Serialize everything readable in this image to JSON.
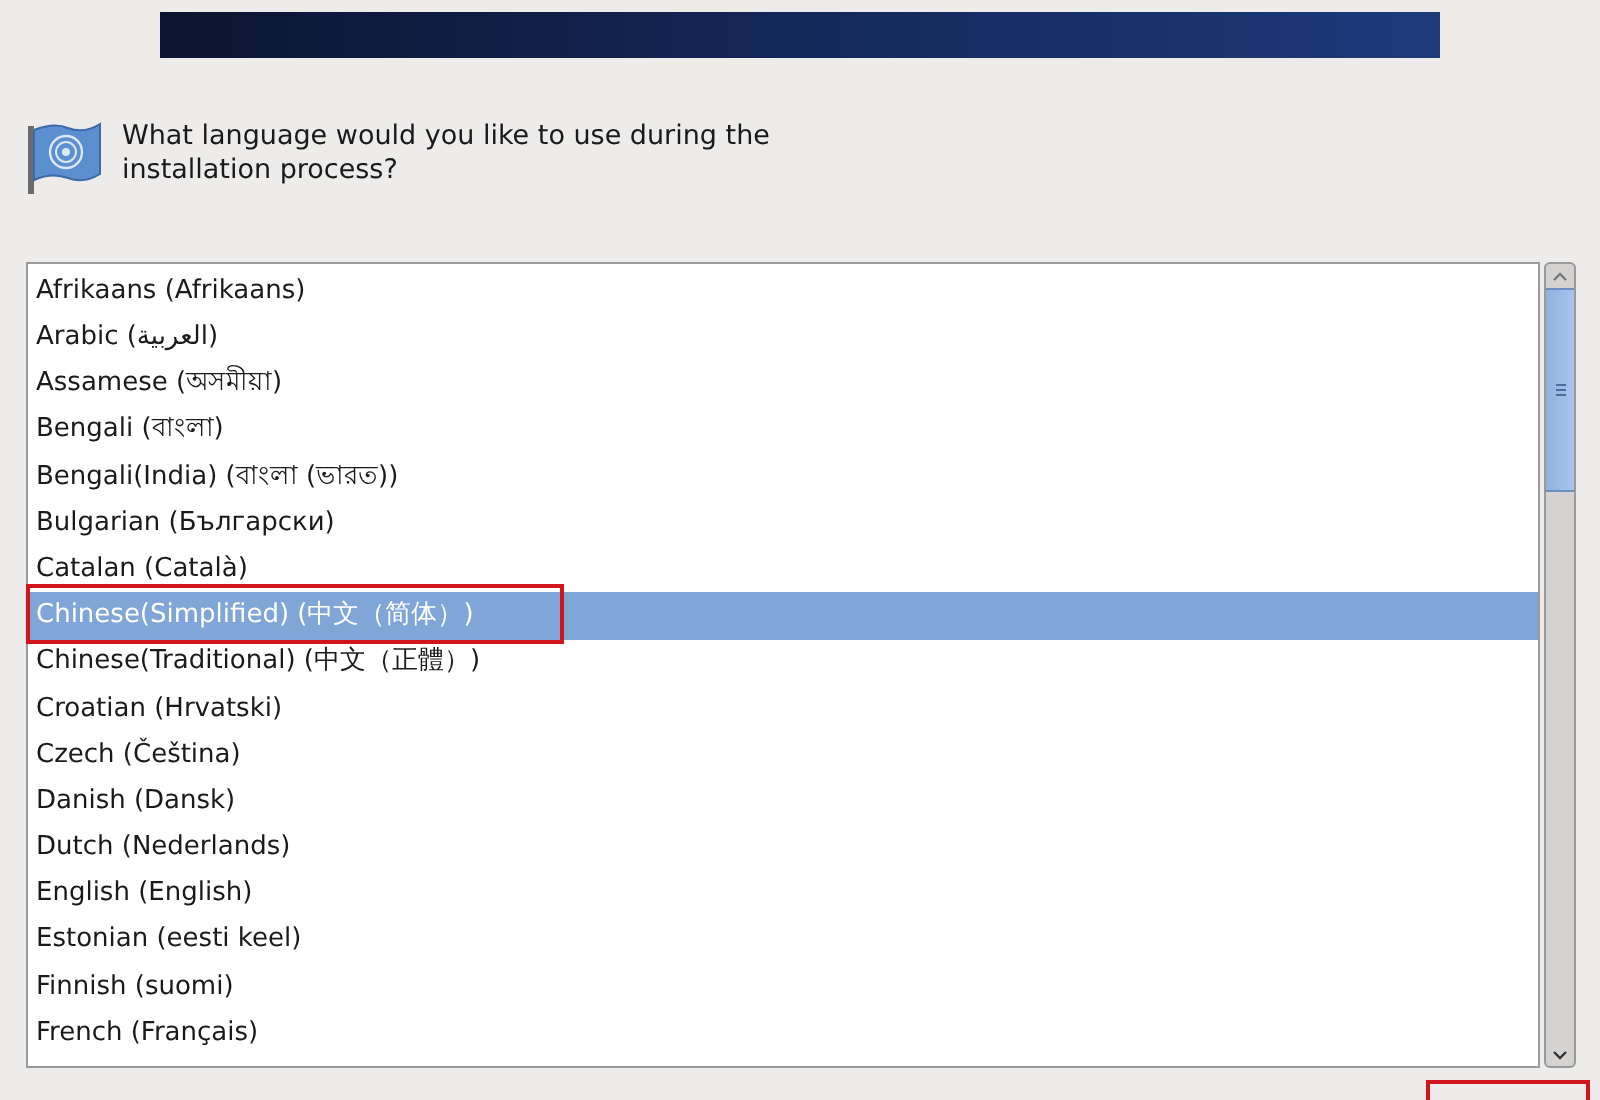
{
  "prompt": "What language would you like to use during the installation process?",
  "languages": [
    {
      "label": "Afrikaans (Afrikaans)",
      "selected": false
    },
    {
      "label": "Arabic (العربية)",
      "selected": false
    },
    {
      "label": "Assamese (অসমীয়া)",
      "selected": false
    },
    {
      "label": "Bengali (বাংলা)",
      "selected": false
    },
    {
      "label": "Bengali(India) (বাংলা (ভারত))",
      "selected": false
    },
    {
      "label": "Bulgarian (Български)",
      "selected": false
    },
    {
      "label": "Catalan (Català)",
      "selected": false
    },
    {
      "label": "Chinese(Simplified) (中文（简体）)",
      "selected": true
    },
    {
      "label": "Chinese(Traditional) (中文（正體）)",
      "selected": false
    },
    {
      "label": "Croatian (Hrvatski)",
      "selected": false
    },
    {
      "label": "Czech (Čeština)",
      "selected": false
    },
    {
      "label": "Danish (Dansk)",
      "selected": false
    },
    {
      "label": "Dutch (Nederlands)",
      "selected": false
    },
    {
      "label": "English (English)",
      "selected": false
    },
    {
      "label": "Estonian (eesti keel)",
      "selected": false
    },
    {
      "label": "Finnish (suomi)",
      "selected": false
    },
    {
      "label": "French (Français)",
      "selected": false
    }
  ]
}
